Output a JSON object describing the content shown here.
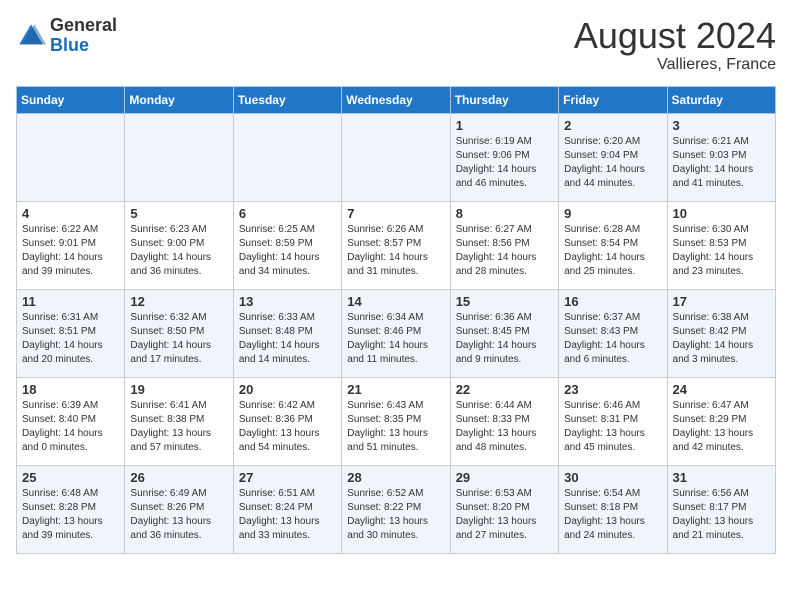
{
  "header": {
    "logo_general": "General",
    "logo_blue": "Blue",
    "month_year": "August 2024",
    "location": "Vallieres, France"
  },
  "days_of_week": [
    "Sunday",
    "Monday",
    "Tuesday",
    "Wednesday",
    "Thursday",
    "Friday",
    "Saturday"
  ],
  "weeks": [
    [
      {
        "day": "",
        "info": ""
      },
      {
        "day": "",
        "info": ""
      },
      {
        "day": "",
        "info": ""
      },
      {
        "day": "",
        "info": ""
      },
      {
        "day": "1",
        "info": "Sunrise: 6:19 AM\nSunset: 9:06 PM\nDaylight: 14 hours\nand 46 minutes."
      },
      {
        "day": "2",
        "info": "Sunrise: 6:20 AM\nSunset: 9:04 PM\nDaylight: 14 hours\nand 44 minutes."
      },
      {
        "day": "3",
        "info": "Sunrise: 6:21 AM\nSunset: 9:03 PM\nDaylight: 14 hours\nand 41 minutes."
      }
    ],
    [
      {
        "day": "4",
        "info": "Sunrise: 6:22 AM\nSunset: 9:01 PM\nDaylight: 14 hours\nand 39 minutes."
      },
      {
        "day": "5",
        "info": "Sunrise: 6:23 AM\nSunset: 9:00 PM\nDaylight: 14 hours\nand 36 minutes."
      },
      {
        "day": "6",
        "info": "Sunrise: 6:25 AM\nSunset: 8:59 PM\nDaylight: 14 hours\nand 34 minutes."
      },
      {
        "day": "7",
        "info": "Sunrise: 6:26 AM\nSunset: 8:57 PM\nDaylight: 14 hours\nand 31 minutes."
      },
      {
        "day": "8",
        "info": "Sunrise: 6:27 AM\nSunset: 8:56 PM\nDaylight: 14 hours\nand 28 minutes."
      },
      {
        "day": "9",
        "info": "Sunrise: 6:28 AM\nSunset: 8:54 PM\nDaylight: 14 hours\nand 25 minutes."
      },
      {
        "day": "10",
        "info": "Sunrise: 6:30 AM\nSunset: 8:53 PM\nDaylight: 14 hours\nand 23 minutes."
      }
    ],
    [
      {
        "day": "11",
        "info": "Sunrise: 6:31 AM\nSunset: 8:51 PM\nDaylight: 14 hours\nand 20 minutes."
      },
      {
        "day": "12",
        "info": "Sunrise: 6:32 AM\nSunset: 8:50 PM\nDaylight: 14 hours\nand 17 minutes."
      },
      {
        "day": "13",
        "info": "Sunrise: 6:33 AM\nSunset: 8:48 PM\nDaylight: 14 hours\nand 14 minutes."
      },
      {
        "day": "14",
        "info": "Sunrise: 6:34 AM\nSunset: 8:46 PM\nDaylight: 14 hours\nand 11 minutes."
      },
      {
        "day": "15",
        "info": "Sunrise: 6:36 AM\nSunset: 8:45 PM\nDaylight: 14 hours\nand 9 minutes."
      },
      {
        "day": "16",
        "info": "Sunrise: 6:37 AM\nSunset: 8:43 PM\nDaylight: 14 hours\nand 6 minutes."
      },
      {
        "day": "17",
        "info": "Sunrise: 6:38 AM\nSunset: 8:42 PM\nDaylight: 14 hours\nand 3 minutes."
      }
    ],
    [
      {
        "day": "18",
        "info": "Sunrise: 6:39 AM\nSunset: 8:40 PM\nDaylight: 14 hours\nand 0 minutes."
      },
      {
        "day": "19",
        "info": "Sunrise: 6:41 AM\nSunset: 8:38 PM\nDaylight: 13 hours\nand 57 minutes."
      },
      {
        "day": "20",
        "info": "Sunrise: 6:42 AM\nSunset: 8:36 PM\nDaylight: 13 hours\nand 54 minutes."
      },
      {
        "day": "21",
        "info": "Sunrise: 6:43 AM\nSunset: 8:35 PM\nDaylight: 13 hours\nand 51 minutes."
      },
      {
        "day": "22",
        "info": "Sunrise: 6:44 AM\nSunset: 8:33 PM\nDaylight: 13 hours\nand 48 minutes."
      },
      {
        "day": "23",
        "info": "Sunrise: 6:46 AM\nSunset: 8:31 PM\nDaylight: 13 hours\nand 45 minutes."
      },
      {
        "day": "24",
        "info": "Sunrise: 6:47 AM\nSunset: 8:29 PM\nDaylight: 13 hours\nand 42 minutes."
      }
    ],
    [
      {
        "day": "25",
        "info": "Sunrise: 6:48 AM\nSunset: 8:28 PM\nDaylight: 13 hours\nand 39 minutes."
      },
      {
        "day": "26",
        "info": "Sunrise: 6:49 AM\nSunset: 8:26 PM\nDaylight: 13 hours\nand 36 minutes."
      },
      {
        "day": "27",
        "info": "Sunrise: 6:51 AM\nSunset: 8:24 PM\nDaylight: 13 hours\nand 33 minutes."
      },
      {
        "day": "28",
        "info": "Sunrise: 6:52 AM\nSunset: 8:22 PM\nDaylight: 13 hours\nand 30 minutes."
      },
      {
        "day": "29",
        "info": "Sunrise: 6:53 AM\nSunset: 8:20 PM\nDaylight: 13 hours\nand 27 minutes."
      },
      {
        "day": "30",
        "info": "Sunrise: 6:54 AM\nSunset: 8:18 PM\nDaylight: 13 hours\nand 24 minutes."
      },
      {
        "day": "31",
        "info": "Sunrise: 6:56 AM\nSunset: 8:17 PM\nDaylight: 13 hours\nand 21 minutes."
      }
    ]
  ]
}
